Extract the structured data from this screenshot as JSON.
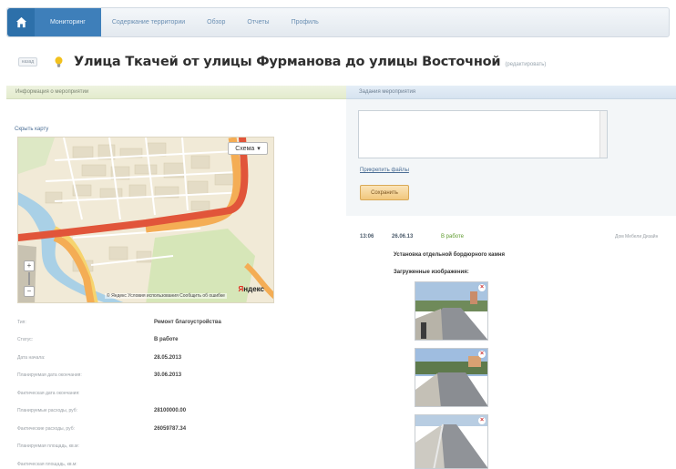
{
  "nav": {
    "tabs": [
      {
        "label": "Мониторинг",
        "active": true
      },
      {
        "label": "Содержание территории",
        "active": false
      },
      {
        "label": "Обзор",
        "active": false
      },
      {
        "label": "Отчеты",
        "active": false
      },
      {
        "label": "Профиль",
        "active": false
      }
    ]
  },
  "title": {
    "back_label": "назад",
    "text": "Улица Ткачей от улицы Фурманова до улицы Восточной",
    "edit_label": "(редактировать)"
  },
  "left": {
    "header": "Информация о мероприятии",
    "hide_map": "Скрыть карту",
    "map": {
      "type_select": "Схема",
      "footer": "© Яндекс  Условия использования  Сообщить об ошибке",
      "logo_a": "Я",
      "logo_b": "ндекс"
    },
    "info": [
      {
        "label": "Тип:",
        "value": "Ремонт благоустройства"
      },
      {
        "label": "Статус:",
        "value": "В работе"
      },
      {
        "label": "Дата начала:",
        "value": "28.05.2013"
      },
      {
        "label": "Планируемая дата окончания:",
        "value": "30.06.2013"
      },
      {
        "label": "Фактическая дата окончания:",
        "value": ""
      },
      {
        "label": "Планируемые расходы, руб:",
        "value": "28100000.00"
      },
      {
        "label": "Фактические расходы, руб:",
        "value": "26059787.34"
      },
      {
        "label": "Планируемая площадь, кв.м:",
        "value": ""
      },
      {
        "label": "Фактическая площадь, кв.м:",
        "value": ""
      }
    ]
  },
  "right": {
    "header": "Задания мероприятия",
    "comment_placeholder": "",
    "attach_label": "Прикрепить файлы",
    "save_label": "Сохранить",
    "entry": {
      "time": "13:06",
      "date": "26.06.13",
      "status": "В работе",
      "author": "Дом Мебели Дизайн",
      "text": "Установка отдельной бордюрного камня",
      "images_label": "Загруженные изображения:"
    },
    "photos": [
      {
        "name": "photo-1",
        "delete_label": "×"
      },
      {
        "name": "photo-2",
        "delete_label": "×"
      },
      {
        "name": "photo-3",
        "delete_label": "×"
      }
    ]
  },
  "colors": {
    "nav_active": "#3e7fba",
    "road_red": "#e1553a",
    "road_orange": "#f4ad55",
    "river": "#a9d0e6",
    "status_green": "#5d9a2c",
    "save_btn": "#f1c77d"
  }
}
